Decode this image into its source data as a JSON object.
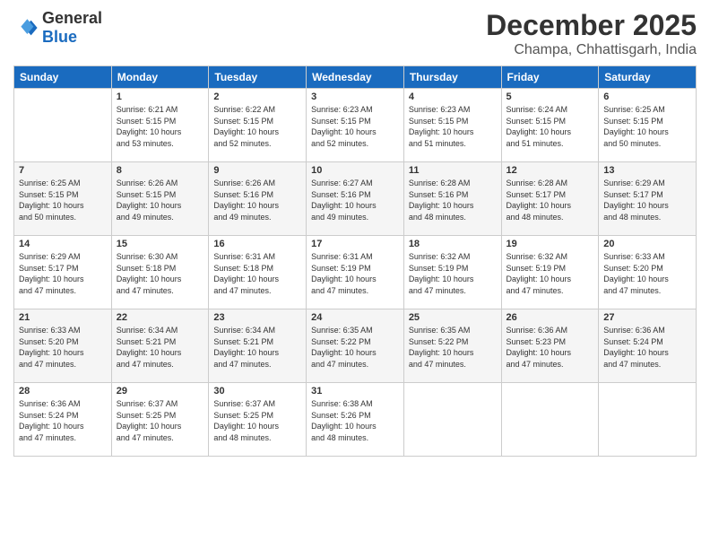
{
  "header": {
    "logo": {
      "general": "General",
      "blue": "Blue"
    },
    "title": "December 2025",
    "location": "Champa, Chhattisgarh, India"
  },
  "calendar": {
    "days_of_week": [
      "Sunday",
      "Monday",
      "Tuesday",
      "Wednesday",
      "Thursday",
      "Friday",
      "Saturday"
    ],
    "weeks": [
      [
        {
          "day": "",
          "info": ""
        },
        {
          "day": "1",
          "info": "Sunrise: 6:21 AM\nSunset: 5:15 PM\nDaylight: 10 hours\nand 53 minutes."
        },
        {
          "day": "2",
          "info": "Sunrise: 6:22 AM\nSunset: 5:15 PM\nDaylight: 10 hours\nand 52 minutes."
        },
        {
          "day": "3",
          "info": "Sunrise: 6:23 AM\nSunset: 5:15 PM\nDaylight: 10 hours\nand 52 minutes."
        },
        {
          "day": "4",
          "info": "Sunrise: 6:23 AM\nSunset: 5:15 PM\nDaylight: 10 hours\nand 51 minutes."
        },
        {
          "day": "5",
          "info": "Sunrise: 6:24 AM\nSunset: 5:15 PM\nDaylight: 10 hours\nand 51 minutes."
        },
        {
          "day": "6",
          "info": "Sunrise: 6:25 AM\nSunset: 5:15 PM\nDaylight: 10 hours\nand 50 minutes."
        }
      ],
      [
        {
          "day": "7",
          "info": "Sunrise: 6:25 AM\nSunset: 5:15 PM\nDaylight: 10 hours\nand 50 minutes."
        },
        {
          "day": "8",
          "info": "Sunrise: 6:26 AM\nSunset: 5:15 PM\nDaylight: 10 hours\nand 49 minutes."
        },
        {
          "day": "9",
          "info": "Sunrise: 6:26 AM\nSunset: 5:16 PM\nDaylight: 10 hours\nand 49 minutes."
        },
        {
          "day": "10",
          "info": "Sunrise: 6:27 AM\nSunset: 5:16 PM\nDaylight: 10 hours\nand 49 minutes."
        },
        {
          "day": "11",
          "info": "Sunrise: 6:28 AM\nSunset: 5:16 PM\nDaylight: 10 hours\nand 48 minutes."
        },
        {
          "day": "12",
          "info": "Sunrise: 6:28 AM\nSunset: 5:17 PM\nDaylight: 10 hours\nand 48 minutes."
        },
        {
          "day": "13",
          "info": "Sunrise: 6:29 AM\nSunset: 5:17 PM\nDaylight: 10 hours\nand 48 minutes."
        }
      ],
      [
        {
          "day": "14",
          "info": "Sunrise: 6:29 AM\nSunset: 5:17 PM\nDaylight: 10 hours\nand 47 minutes."
        },
        {
          "day": "15",
          "info": "Sunrise: 6:30 AM\nSunset: 5:18 PM\nDaylight: 10 hours\nand 47 minutes."
        },
        {
          "day": "16",
          "info": "Sunrise: 6:31 AM\nSunset: 5:18 PM\nDaylight: 10 hours\nand 47 minutes."
        },
        {
          "day": "17",
          "info": "Sunrise: 6:31 AM\nSunset: 5:19 PM\nDaylight: 10 hours\nand 47 minutes."
        },
        {
          "day": "18",
          "info": "Sunrise: 6:32 AM\nSunset: 5:19 PM\nDaylight: 10 hours\nand 47 minutes."
        },
        {
          "day": "19",
          "info": "Sunrise: 6:32 AM\nSunset: 5:19 PM\nDaylight: 10 hours\nand 47 minutes."
        },
        {
          "day": "20",
          "info": "Sunrise: 6:33 AM\nSunset: 5:20 PM\nDaylight: 10 hours\nand 47 minutes."
        }
      ],
      [
        {
          "day": "21",
          "info": "Sunrise: 6:33 AM\nSunset: 5:20 PM\nDaylight: 10 hours\nand 47 minutes."
        },
        {
          "day": "22",
          "info": "Sunrise: 6:34 AM\nSunset: 5:21 PM\nDaylight: 10 hours\nand 47 minutes."
        },
        {
          "day": "23",
          "info": "Sunrise: 6:34 AM\nSunset: 5:21 PM\nDaylight: 10 hours\nand 47 minutes."
        },
        {
          "day": "24",
          "info": "Sunrise: 6:35 AM\nSunset: 5:22 PM\nDaylight: 10 hours\nand 47 minutes."
        },
        {
          "day": "25",
          "info": "Sunrise: 6:35 AM\nSunset: 5:22 PM\nDaylight: 10 hours\nand 47 minutes."
        },
        {
          "day": "26",
          "info": "Sunrise: 6:36 AM\nSunset: 5:23 PM\nDaylight: 10 hours\nand 47 minutes."
        },
        {
          "day": "27",
          "info": "Sunrise: 6:36 AM\nSunset: 5:24 PM\nDaylight: 10 hours\nand 47 minutes."
        }
      ],
      [
        {
          "day": "28",
          "info": "Sunrise: 6:36 AM\nSunset: 5:24 PM\nDaylight: 10 hours\nand 47 minutes."
        },
        {
          "day": "29",
          "info": "Sunrise: 6:37 AM\nSunset: 5:25 PM\nDaylight: 10 hours\nand 47 minutes."
        },
        {
          "day": "30",
          "info": "Sunrise: 6:37 AM\nSunset: 5:25 PM\nDaylight: 10 hours\nand 48 minutes."
        },
        {
          "day": "31",
          "info": "Sunrise: 6:38 AM\nSunset: 5:26 PM\nDaylight: 10 hours\nand 48 minutes."
        },
        {
          "day": "",
          "info": ""
        },
        {
          "day": "",
          "info": ""
        },
        {
          "day": "",
          "info": ""
        }
      ]
    ]
  }
}
